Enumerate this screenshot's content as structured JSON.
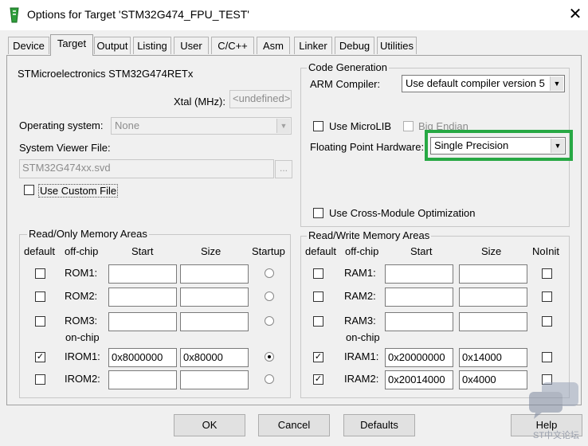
{
  "window": {
    "title": "Options for Target 'STM32G474_FPU_TEST'",
    "close_glyph": "✕"
  },
  "tabs": [
    {
      "label": "Device"
    },
    {
      "label": "Target"
    },
    {
      "label": "Output"
    },
    {
      "label": "Listing"
    },
    {
      "label": "User"
    },
    {
      "label": "C/C++"
    },
    {
      "label": "Asm"
    },
    {
      "label": "Linker"
    },
    {
      "label": "Debug"
    },
    {
      "label": "Utilities"
    }
  ],
  "active_tab": "Target",
  "device_name": "STMicroelectronics STM32G474RETx",
  "xtal": {
    "label": "Xtal (MHz):",
    "value": "<undefined>"
  },
  "os": {
    "label": "Operating system:",
    "value": "None"
  },
  "svd": {
    "label": "System Viewer File:",
    "value": "STM32G474xx.svd",
    "browse": "..."
  },
  "custom_file": {
    "label": "Use Custom File",
    "checked": false
  },
  "code_gen": {
    "title": "Code Generation",
    "compiler_label": "ARM Compiler:",
    "compiler_value": "Use default compiler version 5",
    "microlib": {
      "label": "Use MicroLIB",
      "checked": false
    },
    "big_endian": {
      "label": "Big Endian",
      "checked": false
    },
    "fpu_label": "Floating Point Hardware:",
    "fpu_value": "Single Precision",
    "cross_module": {
      "label": "Use Cross-Module Optimization",
      "checked": false
    }
  },
  "rom": {
    "title": "Read/Only Memory Areas",
    "headers": {
      "default": "default",
      "offchip": "off-chip",
      "start": "Start",
      "size": "Size",
      "startup": "Startup"
    },
    "onchip_label": "on-chip",
    "rows": [
      {
        "label": "ROM1:",
        "start": "",
        "size": "",
        "default": false,
        "startup": false
      },
      {
        "label": "ROM2:",
        "start": "",
        "size": "",
        "default": false,
        "startup": false
      },
      {
        "label": "ROM3:",
        "start": "",
        "size": "",
        "default": false,
        "startup": false
      },
      {
        "label": "IROM1:",
        "start": "0x8000000",
        "size": "0x80000",
        "default": true,
        "startup": true
      },
      {
        "label": "IROM2:",
        "start": "",
        "size": "",
        "default": false,
        "startup": false
      }
    ]
  },
  "ram": {
    "title": "Read/Write Memory Areas",
    "headers": {
      "default": "default",
      "offchip": "off-chip",
      "start": "Start",
      "size": "Size",
      "noinit": "NoInit"
    },
    "onchip_label": "on-chip",
    "rows": [
      {
        "label": "RAM1:",
        "start": "",
        "size": "",
        "default": false,
        "noinit": false
      },
      {
        "label": "RAM2:",
        "start": "",
        "size": "",
        "default": false,
        "noinit": false
      },
      {
        "label": "RAM3:",
        "start": "",
        "size": "",
        "default": false,
        "noinit": false
      },
      {
        "label": "IRAM1:",
        "start": "0x20000000",
        "size": "0x14000",
        "default": true,
        "noinit": false
      },
      {
        "label": "IRAM2:",
        "start": "0x20014000",
        "size": "0x4000",
        "default": true,
        "noinit": false
      }
    ]
  },
  "buttons": {
    "ok": "OK",
    "cancel": "Cancel",
    "defaults": "Defaults",
    "help": "Help"
  },
  "watermark": "ST中文论坛",
  "colors": {
    "highlight": "#27a844"
  },
  "check_glyph": "✓",
  "dropdown_glyph": "▼"
}
